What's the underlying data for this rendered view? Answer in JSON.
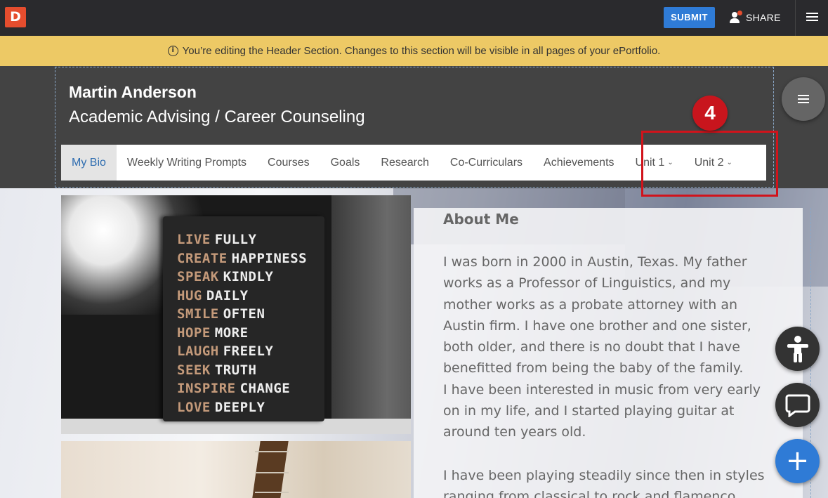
{
  "app": {
    "logo_letter": "D"
  },
  "topbar": {
    "submit_label": "SUBMIT",
    "share_label": "SHARE"
  },
  "notice": {
    "text": "You’re editing the Header Section. Changes to this section will be visible in all pages of your ePortfolio."
  },
  "header": {
    "name": "Martin Anderson",
    "subtitle": "Academic Advising / Career Counseling"
  },
  "nav": {
    "items": [
      {
        "label": "My Bio",
        "active": true
      },
      {
        "label": "Weekly Writing Prompts"
      },
      {
        "label": "Courses"
      },
      {
        "label": "Goals"
      },
      {
        "label": "Research"
      },
      {
        "label": "Co-Curriculars"
      },
      {
        "label": "Achievements"
      },
      {
        "label": "Unit 1",
        "dropdown": true
      },
      {
        "label": "Unit 2",
        "dropdown": true
      }
    ]
  },
  "annotation": {
    "badge": "4",
    "color": "#c8151d"
  },
  "poster": {
    "lines": [
      {
        "a": "LIVE",
        "b": "FULLY"
      },
      {
        "a": "CREATE",
        "b": "HAPPINESS"
      },
      {
        "a": "SPEAK",
        "b": "KINDLY"
      },
      {
        "a": "HUG",
        "b": "DAILY"
      },
      {
        "a": "SMILE",
        "b": "OFTEN"
      },
      {
        "a": "HOPE",
        "b": "MORE"
      },
      {
        "a": "LAUGH",
        "b": "FREELY"
      },
      {
        "a": "SEEK",
        "b": "TRUTH"
      },
      {
        "a": "INSPIRE",
        "b": "CHANGE"
      },
      {
        "a": "LOVE",
        "b": "DEEPLY"
      }
    ]
  },
  "about": {
    "title": "About Me",
    "p1": [
      "I was born in 2000 in Austin, Texas. My father",
      "works as a Professor of Linguistics, and my",
      "mother works as a probate attorney with an",
      "Austin firm. I have one brother and one sister,",
      "both older, and there is no doubt that I have",
      "benefitted from being the baby of the family.",
      "I have been interested in music from very early",
      "on in my life, and I started playing guitar at",
      "around ten years old."
    ],
    "p2": [
      "I have been playing steadily since then in styles",
      "ranging from classical to rock and flamenco."
    ]
  },
  "fabs": {
    "add_symbol": "+"
  },
  "colors": {
    "accent": "#2f7bd6",
    "topbar": "#2a2a2d",
    "notice": "#edc965",
    "header": "#434343",
    "logo": "#e54d2e"
  },
  "icons": [
    "info-icon",
    "person-icon",
    "menu-icon",
    "accessibility-icon",
    "chat-icon",
    "plus-icon",
    "chevron-down-icon"
  ]
}
